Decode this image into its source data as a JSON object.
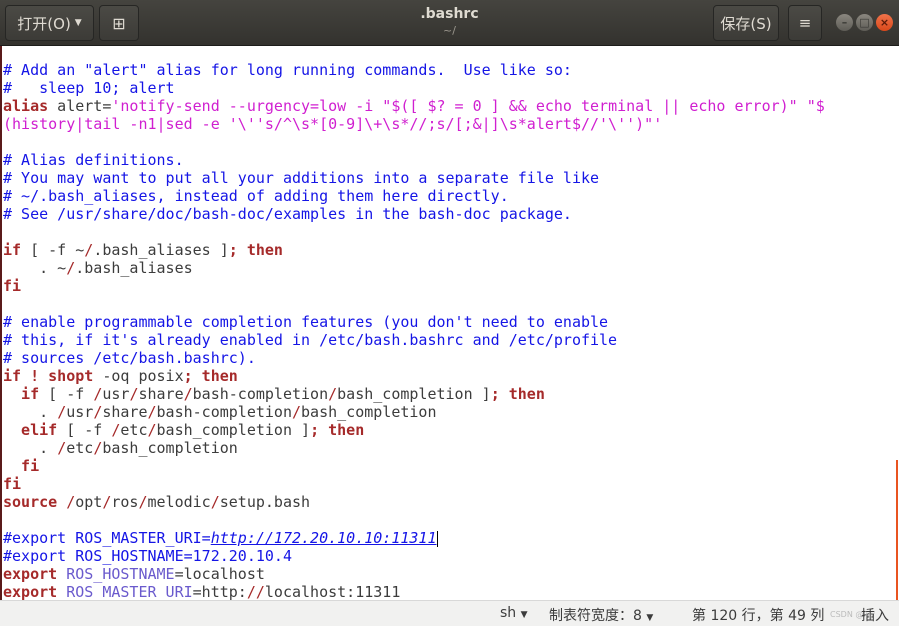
{
  "header": {
    "open_label": "打开(O)",
    "new_tab_icon": "new-document-icon",
    "title": ".bashrc",
    "subtitle": "~/",
    "save_label": "保存(S)",
    "menu_icon": "hamburger-menu-icon",
    "window_controls": [
      "minimize",
      "maximize",
      "close"
    ]
  },
  "editor": {
    "lines": [
      [
        [
          "c",
          "# Add an \"alert\" alias for long running commands.  Use like so:"
        ]
      ],
      [
        [
          "c",
          "#   sleep 10; alert"
        ]
      ],
      [
        [
          "k",
          "alias"
        ],
        [
          "p",
          " alert="
        ],
        [
          "s",
          "'notify-send --urgency=low -i \"$([ $? = 0 ] && echo terminal || echo error)\" \"$"
        ]
      ],
      [
        [
          "s",
          "(history|tail -n1|sed -e '\\''s/^\\s*[0-9]\\+\\s*//;s/[;&|]\\s*alert$//'\\'')\"'"
        ]
      ],
      [],
      [
        [
          "c",
          "# Alias definitions."
        ]
      ],
      [
        [
          "c",
          "# You may want to put all your additions into a separate file like"
        ]
      ],
      [
        [
          "c",
          "# ~/.bash_aliases, instead of adding them here directly."
        ]
      ],
      [
        [
          "c",
          "# See /usr/share/doc/bash-doc/examples in the bash-doc package."
        ]
      ],
      [],
      [
        [
          "k",
          "if"
        ],
        [
          "p",
          " [ -f ~"
        ],
        [
          "sl",
          "/"
        ],
        [
          "p",
          ".bash_aliases ]"
        ],
        [
          "k",
          "; then"
        ]
      ],
      [
        [
          "p",
          "    . ~"
        ],
        [
          "sl",
          "/"
        ],
        [
          "p",
          ".bash_aliases"
        ]
      ],
      [
        [
          "k",
          "fi"
        ]
      ],
      [],
      [
        [
          "c",
          "# enable programmable completion features (you don't need to enable"
        ]
      ],
      [
        [
          "c",
          "# this, if it's already enabled in /etc/bash.bashrc and /etc/profile"
        ]
      ],
      [
        [
          "c",
          "# sources /etc/bash.bashrc)."
        ]
      ],
      [
        [
          "k",
          "if ! shopt"
        ],
        [
          "p",
          " -oq posix"
        ],
        [
          "k",
          "; then"
        ]
      ],
      [
        [
          "k",
          "  if"
        ],
        [
          "p",
          " [ -f "
        ],
        [
          "sl",
          "/"
        ],
        [
          "p",
          "usr"
        ],
        [
          "sl",
          "/"
        ],
        [
          "p",
          "share"
        ],
        [
          "sl",
          "/"
        ],
        [
          "p",
          "bash-completion"
        ],
        [
          "sl",
          "/"
        ],
        [
          "p",
          "bash_completion ]"
        ],
        [
          "k",
          "; then"
        ]
      ],
      [
        [
          "p",
          "    . "
        ],
        [
          "sl",
          "/"
        ],
        [
          "p",
          "usr"
        ],
        [
          "sl",
          "/"
        ],
        [
          "p",
          "share"
        ],
        [
          "sl",
          "/"
        ],
        [
          "p",
          "bash-completion"
        ],
        [
          "sl",
          "/"
        ],
        [
          "p",
          "bash_completion"
        ]
      ],
      [
        [
          "k",
          "  elif"
        ],
        [
          "p",
          " [ -f "
        ],
        [
          "sl",
          "/"
        ],
        [
          "p",
          "etc"
        ],
        [
          "sl",
          "/"
        ],
        [
          "p",
          "bash_completion ]"
        ],
        [
          "k",
          "; then"
        ]
      ],
      [
        [
          "p",
          "    . "
        ],
        [
          "sl",
          "/"
        ],
        [
          "p",
          "etc"
        ],
        [
          "sl",
          "/"
        ],
        [
          "p",
          "bash_completion"
        ]
      ],
      [
        [
          "k",
          "  fi"
        ]
      ],
      [
        [
          "k",
          "fi"
        ]
      ],
      [
        [
          "k",
          "source"
        ],
        [
          "p",
          " "
        ],
        [
          "sl",
          "/"
        ],
        [
          "p",
          "opt"
        ],
        [
          "sl",
          "/"
        ],
        [
          "p",
          "ros"
        ],
        [
          "sl",
          "/"
        ],
        [
          "p",
          "melodic"
        ],
        [
          "sl",
          "/"
        ],
        [
          "p",
          "setup.bash"
        ]
      ],
      [],
      [
        [
          "c",
          "#export ROS_MASTER_URI="
        ],
        [
          "u",
          "http://172.20.10.10:11311"
        ],
        [
          "cursor",
          ""
        ]
      ],
      [
        [
          "c",
          "#export ROS_HOSTNAME=172.20.10.4"
        ]
      ],
      [
        [
          "k",
          "export"
        ],
        [
          "v",
          " ROS_HOSTNAME"
        ],
        [
          "p",
          "=localhost"
        ]
      ],
      [
        [
          "k",
          "export"
        ],
        [
          "v",
          " ROS_MASTER_URI"
        ],
        [
          "p",
          "=http:"
        ],
        [
          "sl",
          "//"
        ],
        [
          "p",
          "localhost:11311"
        ]
      ]
    ]
  },
  "status": {
    "language": "sh",
    "tab_width": "制表符宽度：8",
    "position": "第 120 行，第 49 列",
    "mode": "插入",
    "watermark": "CSDN @lyy"
  }
}
